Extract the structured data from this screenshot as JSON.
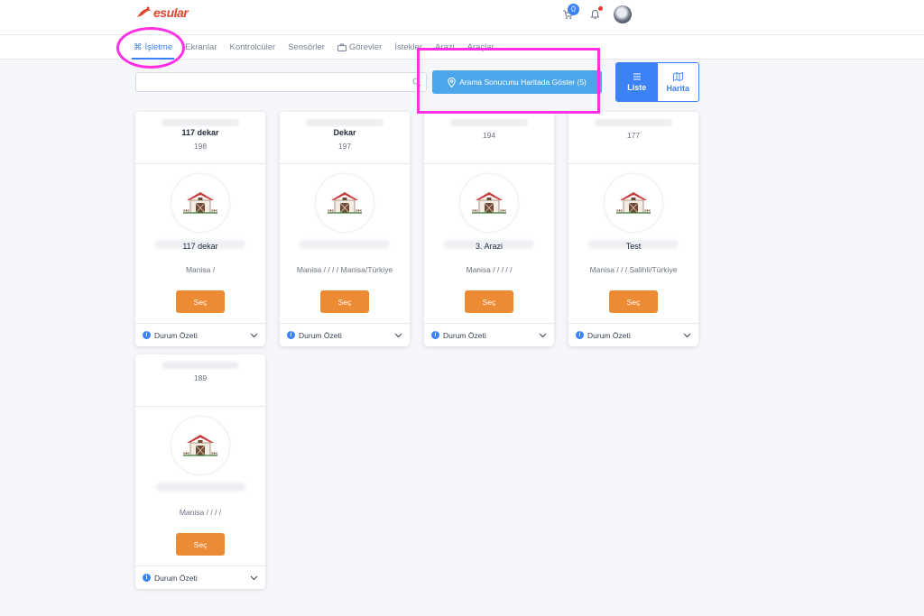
{
  "brand": {
    "name": "esular"
  },
  "header": {
    "cart_count": "0"
  },
  "nav": {
    "items": [
      {
        "label": "İşletme",
        "icon": "command-icon",
        "active": true
      },
      {
        "label": "Ekranlar"
      },
      {
        "label": "Kontrolcüler"
      },
      {
        "label": "Sensörler"
      },
      {
        "label": "Görevler",
        "icon": "briefcase-icon"
      },
      {
        "label": "İstekler"
      },
      {
        "label": "Arazi"
      },
      {
        "label": "Araçlar"
      }
    ]
  },
  "search": {
    "placeholder": ""
  },
  "map_button": {
    "label": "Arama Sonucunu Haritada Göster (5)"
  },
  "view_toggle": {
    "list_label": "Liste",
    "map_label": "Harita"
  },
  "cards": [
    {
      "title": "117 dekar",
      "number": "198",
      "name": "117 dekar",
      "location": "Manisa /",
      "button": "Seç",
      "footer": "Durum Özeti"
    },
    {
      "title": "Dekar",
      "number": "197",
      "name": "",
      "location": "Manisa / / / / Manisa/Türkiye",
      "button": "Seç",
      "footer": "Durum Özeti"
    },
    {
      "title": "",
      "number": "194",
      "name": "3. Arazi",
      "location": "Manisa / / / / /",
      "button": "Seç",
      "footer": "Durum Özeti"
    },
    {
      "title": "",
      "number": "177",
      "name": "Test",
      "location": "Manisa / / / Salihli/Türkiye",
      "button": "Seç",
      "footer": "Durum Özeti"
    },
    {
      "title": "",
      "number": "189",
      "name": "",
      "location": "Manisa / / / /",
      "button": "Seç",
      "footer": "Durum Özeti"
    }
  ],
  "colors": {
    "primary": "#3b82f6",
    "accent": "#ed8a34",
    "map_button": "#4ca7ea",
    "annotation": "#ff2fe6"
  }
}
